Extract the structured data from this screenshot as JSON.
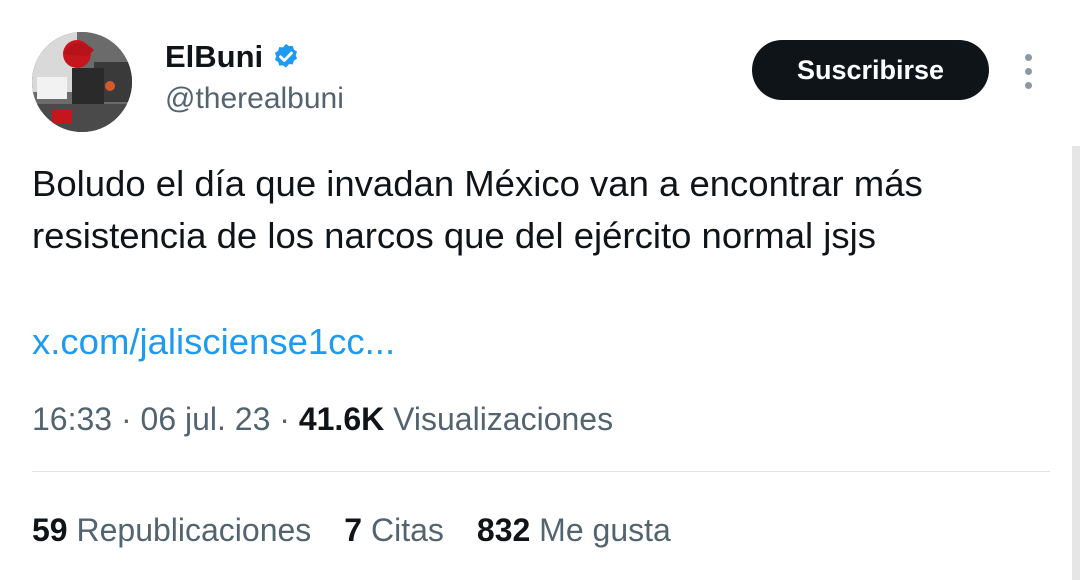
{
  "author": {
    "display_name": "ElBuni",
    "handle": "@therealbuni",
    "verified_icon": "verified-badge-icon",
    "avatar": "profile-avatar"
  },
  "header": {
    "subscribe_label": "Suscribirse",
    "more_icon": "more-vertical-icon"
  },
  "tweet": {
    "text": "Boludo el día que invadan México van a encontrar más\nresistencia de los narcos que del ejército normal jsjs",
    "link": "x.com/jalisciense1cc..."
  },
  "meta": {
    "time": "16:33",
    "separator": " · ",
    "date": "06 jul. 23",
    "views_count": "41.6K",
    "views_label": "Visualizaciones"
  },
  "stats": {
    "reposts_count": "59",
    "reposts_label": "Republicaciones",
    "quotes_count": "7",
    "quotes_label": "Citas",
    "likes_count": "832",
    "likes_label": "Me gusta"
  },
  "colors": {
    "accent": "#1d9bf0",
    "text": "#0f1419",
    "secondary": "#536471",
    "button": "#0f1419"
  }
}
